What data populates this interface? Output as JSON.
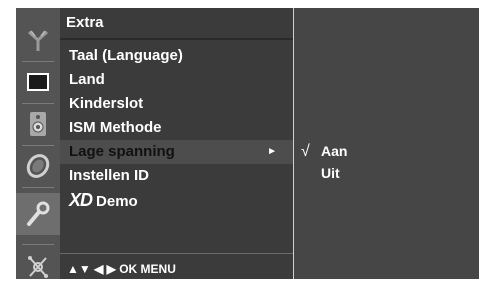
{
  "menu": {
    "title": "Extra",
    "items": [
      {
        "label": "Taal (Language)"
      },
      {
        "label": "Land"
      },
      {
        "label": "Kinderslot"
      },
      {
        "label": "ISM Methode"
      },
      {
        "label": "Lage spanning",
        "selected": true
      },
      {
        "label": "Instellen ID"
      },
      {
        "logo": "XD",
        "label": "Demo"
      }
    ],
    "nav_hint": "▲▼ ◀ ▶ OK  MENU"
  },
  "submenu": {
    "options": [
      {
        "check": "√",
        "label": "Aan",
        "checked": true
      },
      {
        "check": "",
        "label": "Uit",
        "checked": false
      }
    ]
  },
  "icons": [
    "antenna-icon",
    "picture-icon",
    "sound-icon",
    "clock-icon",
    "extra-icon",
    "input-icon"
  ],
  "colors": {
    "rail": "#545454",
    "panel": "#3b3b3b",
    "highlight": "#4d4d4d",
    "subpanel": "#464646",
    "text": "#ffffff"
  }
}
